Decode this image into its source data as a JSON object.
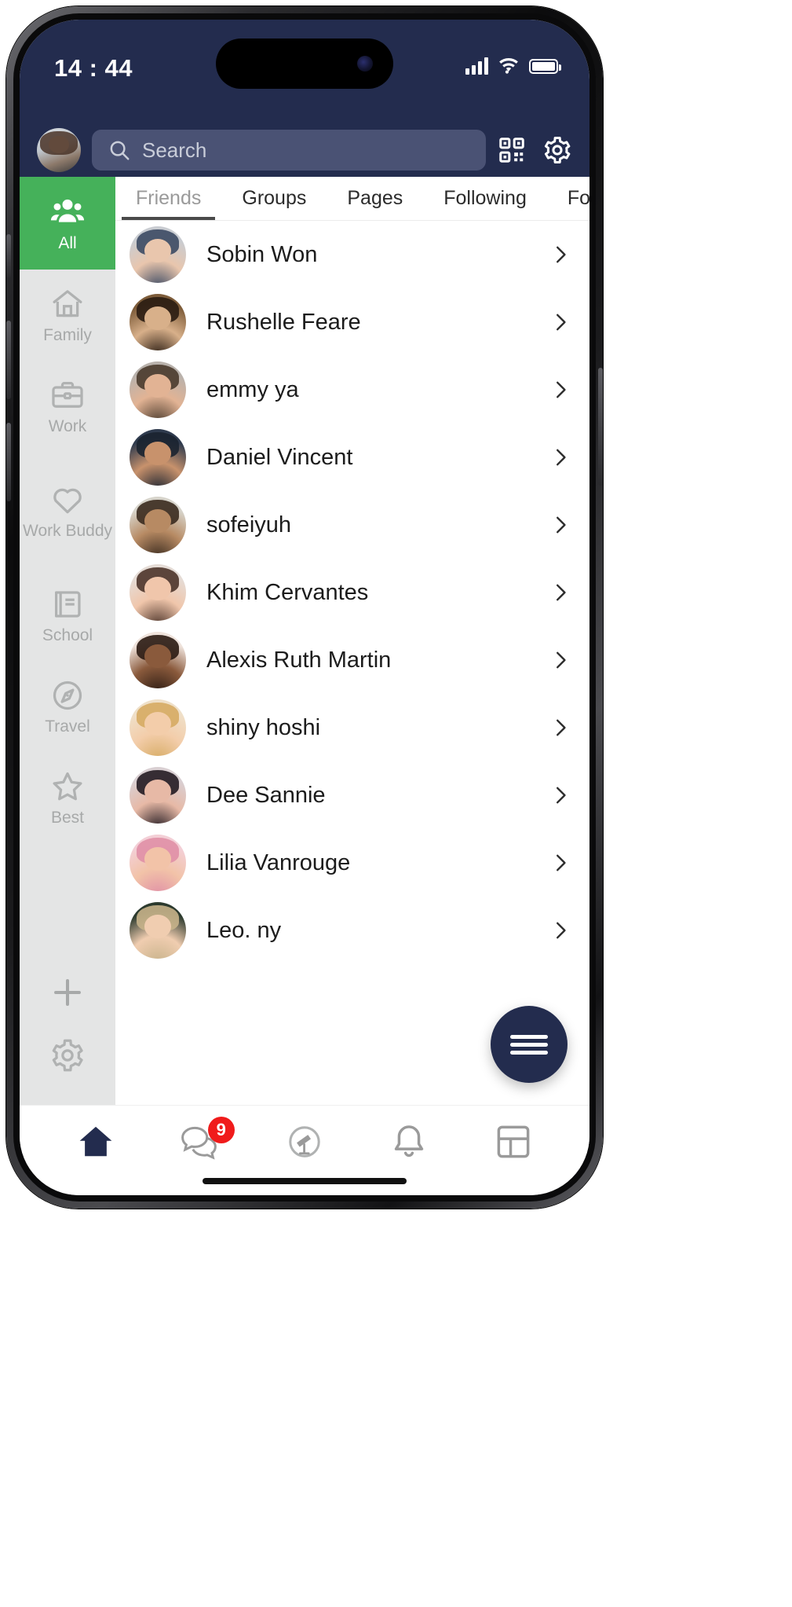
{
  "status_bar": {
    "time": "14 : 44",
    "signal_icon": "cellular-signal-icon",
    "wifi_icon": "wifi-icon",
    "battery_icon": "battery-full-icon"
  },
  "header": {
    "avatar_name": "my-profile-avatar",
    "search": {
      "placeholder": "Search",
      "value": "",
      "icon": "search-icon"
    },
    "qr_icon": "qr-code-icon",
    "settings_icon": "gear-icon"
  },
  "sidebar": {
    "items": [
      {
        "label": "All",
        "icon": "people-group-icon",
        "active": true
      },
      {
        "label": "Family",
        "icon": "home-icon",
        "active": false
      },
      {
        "label": "Work",
        "icon": "briefcase-icon",
        "active": false
      },
      {
        "label": "Work Buddy",
        "icon": "heart-icon",
        "active": false
      },
      {
        "label": "School",
        "icon": "book-icon",
        "active": false
      },
      {
        "label": "Travel",
        "icon": "compass-icon",
        "active": false
      },
      {
        "label": "Best",
        "icon": "star-icon",
        "active": false
      }
    ],
    "add_icon": "plus-icon",
    "settings_icon": "gear-icon"
  },
  "tabs": [
    {
      "label": "Friends",
      "active": true
    },
    {
      "label": "Groups",
      "active": false
    },
    {
      "label": "Pages",
      "active": false
    },
    {
      "label": "Following",
      "active": false
    },
    {
      "label": "Followers",
      "active": false
    }
  ],
  "friends": [
    {
      "name": "Sobin Won"
    },
    {
      "name": "Rushelle Feare"
    },
    {
      "name": "emmy ya"
    },
    {
      "name": "Daniel Vincent"
    },
    {
      "name": "sofeiyuh"
    },
    {
      "name": "Khim Cervantes"
    },
    {
      "name": "Alexis Ruth Martin"
    },
    {
      "name": "shiny hoshi"
    },
    {
      "name": "Dee Sannie"
    },
    {
      "name": "Lilia Vanrouge"
    },
    {
      "name": "Leo. ny"
    }
  ],
  "fab": {
    "icon": "hamburger-menu-icon"
  },
  "bottom_nav": [
    {
      "icon": "home-icon",
      "active": true,
      "badge": ""
    },
    {
      "icon": "chat-bubbles-icon",
      "active": false,
      "badge": "9"
    },
    {
      "icon": "telescope-icon",
      "active": false,
      "badge": ""
    },
    {
      "icon": "bell-icon",
      "active": false,
      "badge": ""
    },
    {
      "icon": "grid-icon",
      "active": false,
      "badge": ""
    }
  ],
  "colors": {
    "header_navy": "#232c4e",
    "accent_green": "#45b15a",
    "badge_red": "#f01b1b",
    "rail_bg": "#e4e5e5"
  }
}
